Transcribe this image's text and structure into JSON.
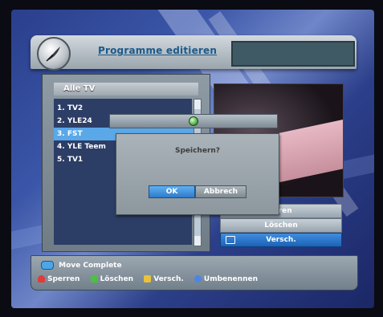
{
  "header": {
    "title": "Programme editieren"
  },
  "channel_list": {
    "header": "Alle TV",
    "items": [
      {
        "label": "1. TV2"
      },
      {
        "label": "2. YLE24"
      },
      {
        "label": "3. FST"
      },
      {
        "label": "4. YLE Teem"
      },
      {
        "label": "5. TV1"
      }
    ],
    "selected_index": 2
  },
  "side_buttons": {
    "btn1": "...ren",
    "btn2": "Löschen",
    "btn3": "Versch."
  },
  "dialog": {
    "message": "Speichern?",
    "ok_label": "OK",
    "cancel_label": "Abbrech"
  },
  "footer": {
    "ok_hint": "Move Complete",
    "hints": [
      {
        "label": "Sperren"
      },
      {
        "label": "Löschen"
      },
      {
        "label": "Versch."
      },
      {
        "label": "Umbenennen"
      }
    ]
  }
}
